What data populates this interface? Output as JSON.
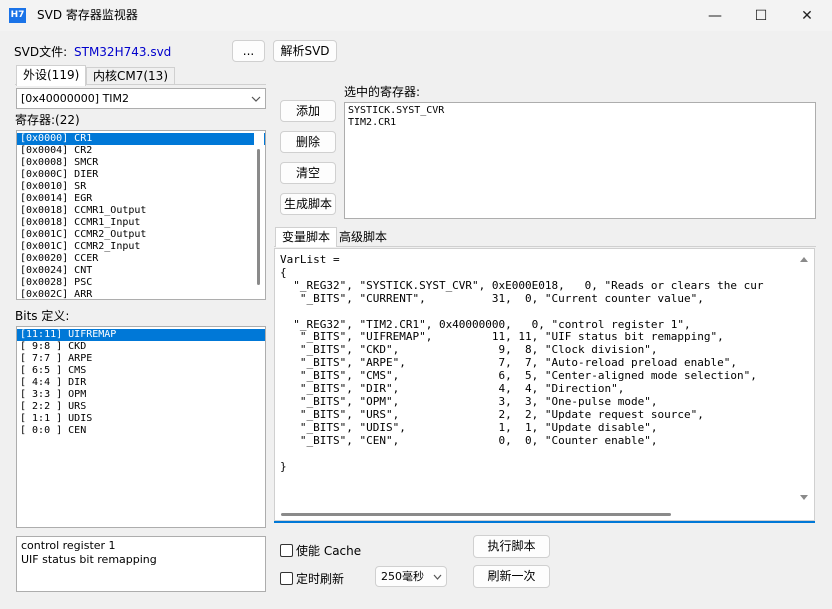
{
  "window": {
    "icon_text": "H7",
    "title": "SVD 寄存器监视器",
    "minimize": "—",
    "maximize": "☐",
    "close": "✕"
  },
  "svd": {
    "label": "SVD文件:",
    "file": "STM32H743.svd",
    "browse_label": "...",
    "parse_label": "解析SVD"
  },
  "tabs": {
    "peripherals": "外设(119)",
    "core": "内核CM7(13)"
  },
  "peripheral_select": {
    "value": "[0x40000000] TIM2"
  },
  "registers": {
    "label": "寄存器:(22)",
    "items": [
      "[0x0000] CR1",
      "[0x0004] CR2",
      "[0x0008] SMCR",
      "[0x000C] DIER",
      "[0x0010] SR",
      "[0x0014] EGR",
      "[0x0018] CCMR1_Output",
      "[0x0018] CCMR1_Input",
      "[0x001C] CCMR2_Output",
      "[0x001C] CCMR2_Input",
      "[0x0020] CCER",
      "[0x0024] CNT",
      "[0x0028] PSC",
      "[0x002C] ARR"
    ]
  },
  "bits": {
    "label": "Bits 定义:",
    "items": [
      "[11:11] UIFREMAP",
      "[ 9:8 ] CKD",
      "[ 7:7 ] ARPE",
      "[ 6:5 ] CMS",
      "[ 4:4 ] DIR",
      "[ 3:3 ] OPM",
      "[ 2:2 ] URS",
      "[ 1:1 ] UDIS",
      "[ 0:0 ] CEN"
    ]
  },
  "status": {
    "text": "control register 1\nUIF status bit remapping"
  },
  "actions": {
    "add": "添加",
    "delete": "删除",
    "clear": "清空",
    "generate": "生成脚本"
  },
  "selected": {
    "label": "选中的寄存器:",
    "items": [
      "SYSTICK.SYST_CVR",
      "TIM2.CR1"
    ]
  },
  "script_tabs": {
    "var_script": "变量脚本",
    "advanced": "高级脚本"
  },
  "script": {
    "code": "VarList =\n{\n  \"_REG32\", \"SYSTICK.SYST_CVR\", 0xE000E018,   0, \"Reads or clears the cur\n   \"_BITS\", \"CURRENT\",          31,  0, \"Current counter value\",\n\n  \"_REG32\", \"TIM2.CR1\", 0x40000000,   0, \"control register 1\",\n   \"_BITS\", \"UIFREMAP\",         11, 11, \"UIF status bit remapping\",\n   \"_BITS\", \"CKD\",               9,  8, \"Clock division\",\n   \"_BITS\", \"ARPE\",              7,  7, \"Auto-reload preload enable\",\n   \"_BITS\", \"CMS\",               6,  5, \"Center-aligned mode selection\",\n   \"_BITS\", \"DIR\",               4,  4, \"Direction\",\n   \"_BITS\", \"OPM\",               3,  3, \"One-pulse mode\",\n   \"_BITS\", \"URS\",               2,  2, \"Update request source\",\n   \"_BITS\", \"UDIS\",              1,  1, \"Update disable\",\n   \"_BITS\", \"CEN\",               0,  0, \"Counter enable\",\n\n}"
  },
  "bottom": {
    "cache_label": "使能 Cache",
    "timer_label": "定时刷新",
    "interval_value": "250毫秒",
    "run_label": "执行脚本",
    "refresh_label": "刷新一次"
  },
  "colors": {
    "accent": "#0078d7",
    "file_link": "#0000cc"
  }
}
